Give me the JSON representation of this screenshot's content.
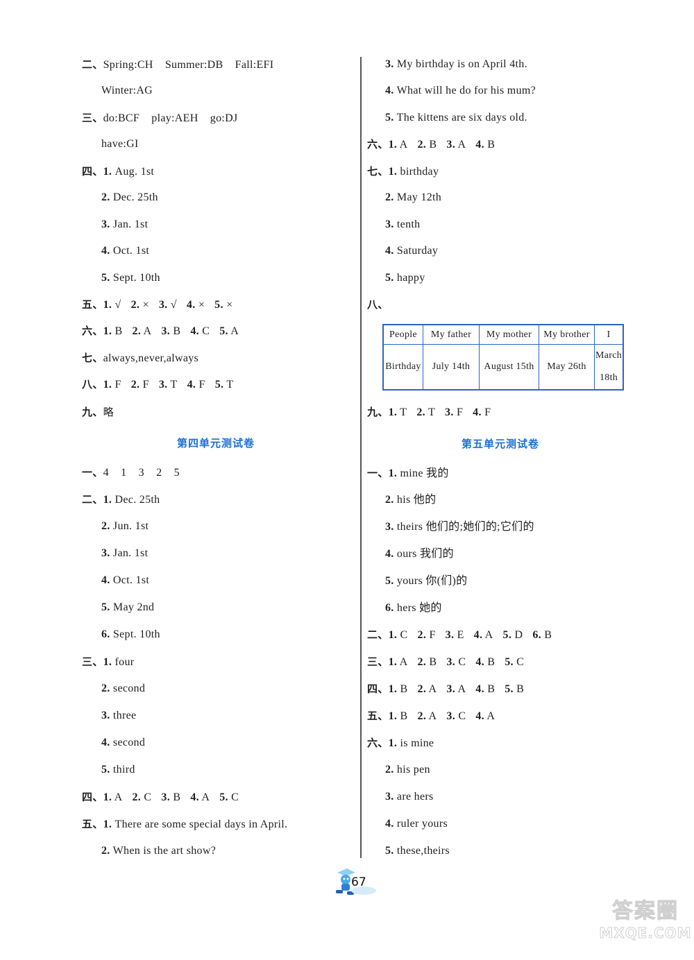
{
  "left_column": {
    "continued_unit": {
      "sections": [
        {
          "numeral": "二、",
          "text": "Spring:CH    Summer:DB    Fall:EFI"
        },
        {
          "numeral": "",
          "text": "Winter:AG"
        },
        {
          "numeral": "三、",
          "text": "do:BCF    play:AEH    go:DJ"
        },
        {
          "numeral": "",
          "text": "have:GI"
        }
      ],
      "section_four": {
        "numeral": "四、",
        "items": [
          {
            "num": "1.",
            "text": "Aug. 1st"
          },
          {
            "num": "2.",
            "text": "Dec. 25th"
          },
          {
            "num": "3.",
            "text": "Jan. 1st"
          },
          {
            "num": "4.",
            "text": "Oct. 1st"
          },
          {
            "num": "5.",
            "text": "Sept. 10th"
          }
        ]
      },
      "section_five": {
        "numeral": "五、",
        "items": [
          {
            "num": "1.",
            "text": "√"
          },
          {
            "num": "2.",
            "text": "×"
          },
          {
            "num": "3.",
            "text": "√"
          },
          {
            "num": "4.",
            "text": "×"
          },
          {
            "num": "5.",
            "text": "×"
          }
        ]
      },
      "section_six": {
        "numeral": "六、",
        "items": [
          {
            "num": "1.",
            "text": "B"
          },
          {
            "num": "2.",
            "text": "A"
          },
          {
            "num": "3.",
            "text": "B"
          },
          {
            "num": "4.",
            "text": "C"
          },
          {
            "num": "5.",
            "text": "A"
          }
        ]
      },
      "section_seven": {
        "numeral": "七、",
        "text": "always,never,always"
      },
      "section_eight": {
        "numeral": "八、",
        "items": [
          {
            "num": "1.",
            "text": "F"
          },
          {
            "num": "2.",
            "text": "F"
          },
          {
            "num": "3.",
            "text": "T"
          },
          {
            "num": "4.",
            "text": "F"
          },
          {
            "num": "5.",
            "text": "T"
          }
        ]
      },
      "section_nine": {
        "numeral": "九、",
        "text": "略"
      }
    },
    "unit4": {
      "heading": "第四单元测试卷",
      "section_one": {
        "numeral": "一、",
        "text": "4    1    3    2    5"
      },
      "section_two": {
        "numeral": "二、",
        "items": [
          {
            "num": "1.",
            "text": "Dec. 25th"
          },
          {
            "num": "2.",
            "text": "Jun. 1st"
          },
          {
            "num": "3.",
            "text": "Jan. 1st"
          },
          {
            "num": "4.",
            "text": "Oct. 1st"
          },
          {
            "num": "5.",
            "text": "May 2nd"
          },
          {
            "num": "6.",
            "text": "Sept. 10th"
          }
        ]
      },
      "section_three": {
        "numeral": "三、",
        "items": [
          {
            "num": "1.",
            "text": "four"
          },
          {
            "num": "2.",
            "text": "second"
          },
          {
            "num": "3.",
            "text": "three"
          },
          {
            "num": "4.",
            "text": "second"
          },
          {
            "num": "5.",
            "text": "third"
          }
        ]
      },
      "section_four": {
        "numeral": "四、",
        "items": [
          {
            "num": "1.",
            "text": "A"
          },
          {
            "num": "2.",
            "text": "C"
          },
          {
            "num": "3.",
            "text": "B"
          },
          {
            "num": "4.",
            "text": "A"
          },
          {
            "num": "5.",
            "text": "C"
          }
        ]
      },
      "section_five": {
        "numeral": "五、",
        "items": [
          {
            "num": "1.",
            "text": "There are some special days in April."
          },
          {
            "num": "2.",
            "text": "When is the art show?"
          }
        ]
      }
    }
  },
  "right_column": {
    "unit4_continued": {
      "section_five_items": [
        {
          "num": "3.",
          "text": "My birthday is on April 4th."
        },
        {
          "num": "4.",
          "text": "What will he do for his mum?"
        },
        {
          "num": "5.",
          "text": "The kittens are six days old."
        }
      ],
      "section_six": {
        "numeral": "六、",
        "items": [
          {
            "num": "1.",
            "text": "A"
          },
          {
            "num": "2.",
            "text": "B"
          },
          {
            "num": "3.",
            "text": "A"
          },
          {
            "num": "4.",
            "text": "B"
          }
        ]
      },
      "section_seven": {
        "numeral": "七、",
        "items": [
          {
            "num": "1.",
            "text": "birthday"
          },
          {
            "num": "2.",
            "text": "May 12th"
          },
          {
            "num": "3.",
            "text": "tenth"
          },
          {
            "num": "4.",
            "text": "Saturday"
          },
          {
            "num": "5.",
            "text": "happy"
          }
        ]
      },
      "section_eight": {
        "numeral": "八、",
        "table": {
          "header": [
            "People",
            "My father",
            "My mother",
            "My brother",
            "I"
          ],
          "row": [
            "Birthday",
            "July 14th",
            "August 15th",
            "May 26th",
            "March 18th"
          ],
          "last_cell_lines": [
            "March",
            "18th"
          ]
        }
      },
      "section_nine": {
        "numeral": "九、",
        "items": [
          {
            "num": "1.",
            "text": "T"
          },
          {
            "num": "2.",
            "text": "T"
          },
          {
            "num": "3.",
            "text": "F"
          },
          {
            "num": "4.",
            "text": "F"
          }
        ]
      }
    },
    "unit5": {
      "heading": "第五单元测试卷",
      "section_one": {
        "numeral": "一、",
        "items": [
          {
            "num": "1.",
            "text": "mine 我的"
          },
          {
            "num": "2.",
            "text": "his 他的"
          },
          {
            "num": "3.",
            "text": "theirs 他们的;她们的;它们的"
          },
          {
            "num": "4.",
            "text": "ours 我们的"
          },
          {
            "num": "5.",
            "text": "yours 你(们)的"
          },
          {
            "num": "6.",
            "text": "hers 她的"
          }
        ]
      },
      "section_two": {
        "numeral": "二、",
        "items": [
          {
            "num": "1.",
            "text": "C"
          },
          {
            "num": "2.",
            "text": "F"
          },
          {
            "num": "3.",
            "text": "E"
          },
          {
            "num": "4.",
            "text": "A"
          },
          {
            "num": "5.",
            "text": "D"
          },
          {
            "num": "6.",
            "text": "B"
          }
        ]
      },
      "section_three": {
        "numeral": "三、",
        "items": [
          {
            "num": "1.",
            "text": "A"
          },
          {
            "num": "2.",
            "text": "B"
          },
          {
            "num": "3.",
            "text": "C"
          },
          {
            "num": "4.",
            "text": "B"
          },
          {
            "num": "5.",
            "text": "C"
          }
        ]
      },
      "section_four": {
        "numeral": "四、",
        "items": [
          {
            "num": "1.",
            "text": "B"
          },
          {
            "num": "2.",
            "text": "A"
          },
          {
            "num": "3.",
            "text": "A"
          },
          {
            "num": "4.",
            "text": "B"
          },
          {
            "num": "5.",
            "text": "B"
          }
        ]
      },
      "section_five": {
        "numeral": "五、",
        "items": [
          {
            "num": "1.",
            "text": "B"
          },
          {
            "num": "2.",
            "text": "A"
          },
          {
            "num": "3.",
            "text": "C"
          },
          {
            "num": "4.",
            "text": "A"
          }
        ]
      },
      "section_six": {
        "numeral": "六、",
        "items": [
          {
            "num": "1.",
            "text": "is mine"
          },
          {
            "num": "2.",
            "text": "his pen"
          },
          {
            "num": "3.",
            "text": "are hers"
          },
          {
            "num": "4.",
            "text": "ruler yours"
          },
          {
            "num": "5.",
            "text": "these,theirs"
          }
        ]
      }
    }
  },
  "footer": {
    "page_number": "67",
    "mascot_icon": "cartoon-mascot-icon"
  },
  "watermark": {
    "line1": "答案圈",
    "line2": "MXQE.COM"
  },
  "colors": {
    "heading": "#1a6fd6",
    "table_border": "#2b63c8",
    "divider": "#555555"
  }
}
